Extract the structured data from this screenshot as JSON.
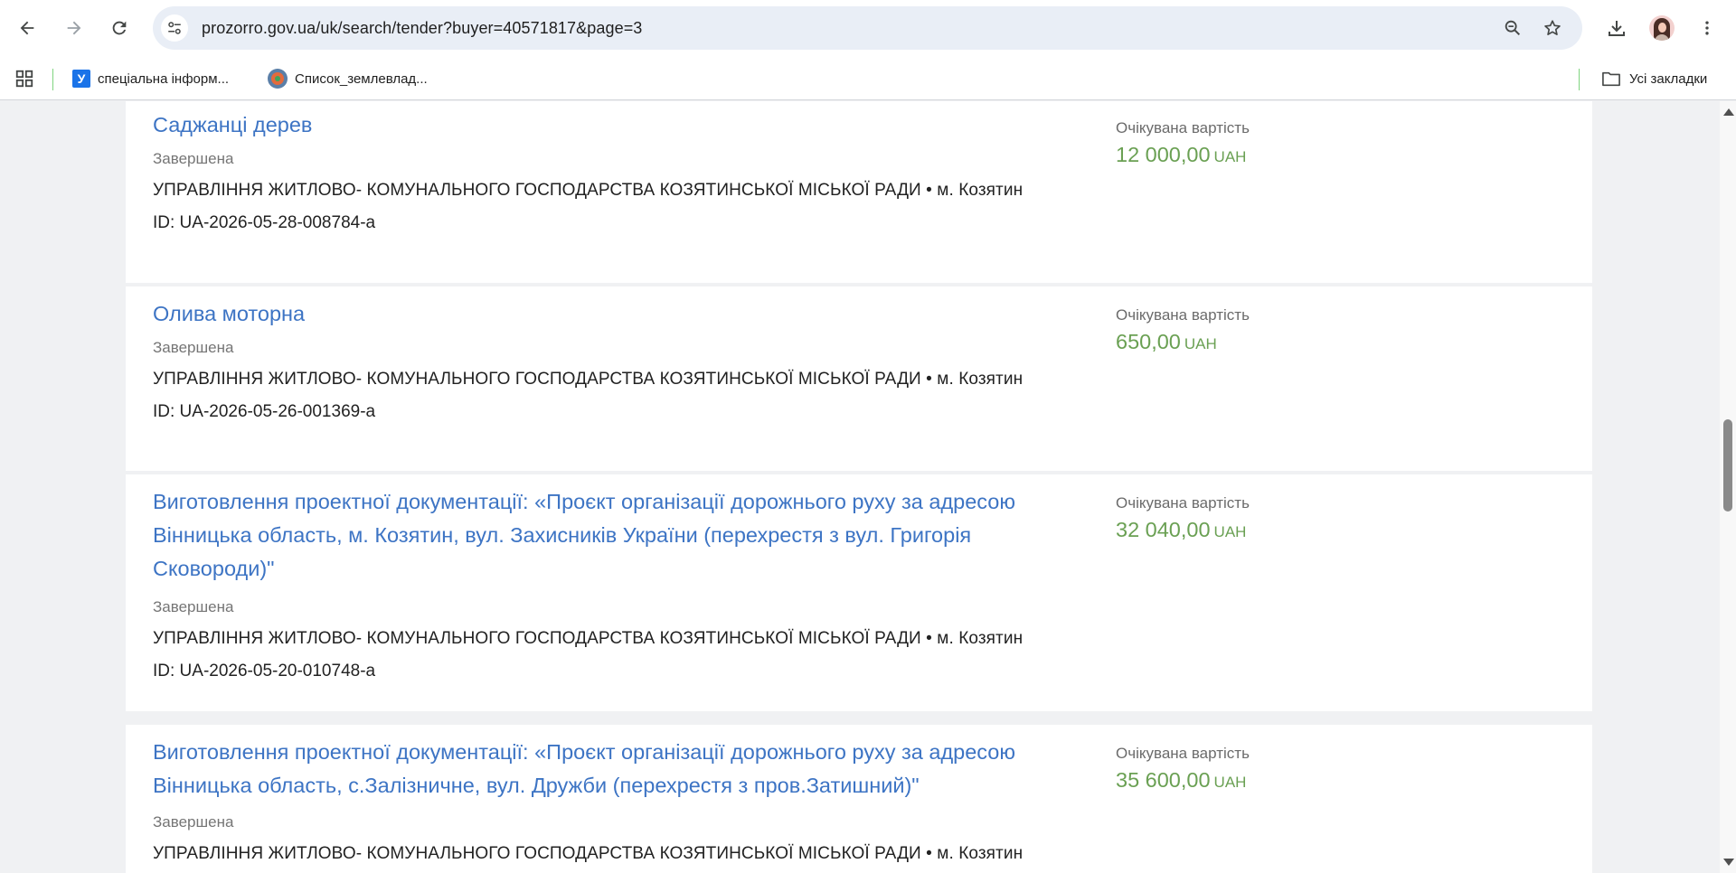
{
  "browser": {
    "url": "prozorro.gov.ua/uk/search/tender?buyer=40571817&page=3",
    "bookmarks": [
      {
        "label": "спеціальна інформ..."
      },
      {
        "label": "Список_землевлад..."
      }
    ],
    "all_bookmarks_label": "Усі закладки"
  },
  "tenders": [
    {
      "title": "Саджанці дерев",
      "status": "Завершена",
      "buyer": "УПРАВЛІННЯ ЖИТЛОВО- КОМУНАЛЬНОГО ГОСПОДАРСТВА КОЗЯТИНСЬКОЇ МІСЬКОЇ РАДИ • м. Козятин",
      "id": "ID: UA-2026-05-28-008784-a",
      "value_label": "Очікувана вартість",
      "value": "12 000,00",
      "currency": "UAH"
    },
    {
      "title": "Олива моторна",
      "status": "Завершена",
      "buyer": "УПРАВЛІННЯ ЖИТЛОВО- КОМУНАЛЬНОГО ГОСПОДАРСТВА КОЗЯТИНСЬКОЇ МІСЬКОЇ РАДИ • м. Козятин",
      "id": "ID: UA-2026-05-26-001369-a",
      "value_label": "Очікувана вартість",
      "value": "650,00",
      "currency": "UAH"
    },
    {
      "title": "Виготовлення проектної документації: «Проєкт організації дорожнього руху за адресою Вінницька область, м. Козятин, вул. Захисників України (перехрестя з вул. Григорія Сковороди)\"",
      "status": "Завершена",
      "buyer": "УПРАВЛІННЯ ЖИТЛОВО- КОМУНАЛЬНОГО ГОСПОДАРСТВА КОЗЯТИНСЬКОЇ МІСЬКОЇ РАДИ • м. Козятин",
      "id": "ID: UA-2026-05-20-010748-a",
      "value_label": "Очікувана вартість",
      "value": "32 040,00",
      "currency": "UAH"
    },
    {
      "title": "Виготовлення проектної документації: «Проєкт організації дорожнього руху за адресою Вінницька область, с.Залізничне, вул. Дружби (перехрестя з пров.Затишний)\"",
      "status": "Завершена",
      "buyer": "УПРАВЛІННЯ ЖИТЛОВО- КОМУНАЛЬНОГО ГОСПОДАРСТВА КОЗЯТИНСЬКОЇ МІСЬКОЇ РАДИ • м. Козятин",
      "id": "",
      "value_label": "Очікувана вартість",
      "value": "35 600,00",
      "currency": "UAH"
    }
  ]
}
